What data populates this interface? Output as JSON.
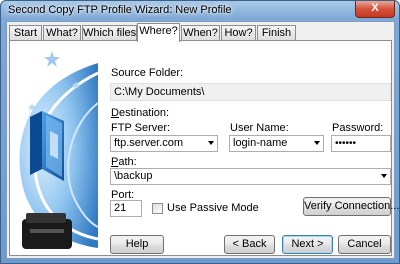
{
  "window": {
    "title": "Second Copy FTP Profile Wizard: New Profile",
    "close_glyph": "X"
  },
  "tabs": [
    {
      "label": "Start"
    },
    {
      "label": "What?"
    },
    {
      "label": "Which files?"
    },
    {
      "label": "Where?",
      "active": true
    },
    {
      "label": "When?"
    },
    {
      "label": "How?"
    },
    {
      "label": "Finish"
    }
  ],
  "form": {
    "source_folder_label": "Source Folder:",
    "source_folder_value": "C:\\My Documents\\",
    "destination_label": "Destination:",
    "ftp_server_label": "FTP Server:",
    "ftp_server_value": "ftp.server.com",
    "username_label": "User Name:",
    "username_value": "login-name",
    "password_label": "Password:",
    "password_value": "••••••",
    "path_label": "Path:",
    "path_value": "\\backup",
    "port_label": "Port:",
    "port_value": "21",
    "passive_mode_label": "Use Passive Mode",
    "passive_mode_checked": false,
    "verify_button": "Verify Connection..."
  },
  "footer": {
    "help_button": "Help",
    "back_button": "< Back",
    "next_button": "Next >",
    "cancel_button": "Cancel"
  },
  "colors": {
    "accent": "#3c7fb1",
    "art_blue": "#1f6fb8"
  }
}
